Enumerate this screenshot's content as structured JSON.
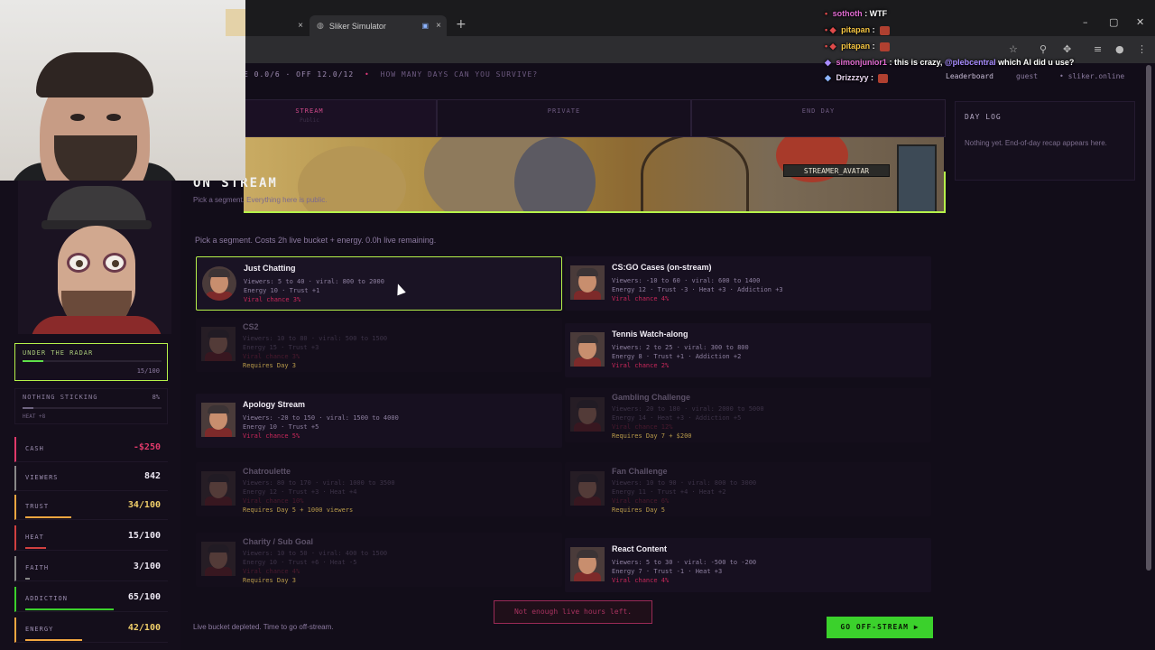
{
  "browser": {
    "tabs": [
      {
        "title": "",
        "close": "×"
      },
      {
        "title": "Sliker Simulator",
        "close": "×"
      }
    ],
    "new_tab": "+",
    "window_controls": [
      "–",
      "▢",
      "✕"
    ]
  },
  "game": {
    "status_text": "E 0.0/6 · OFF 12.0/12",
    "tagline": "HOW MANY DAYS CAN YOU SURVIVE?",
    "nav": {
      "leaderboard": "Leaderboard",
      "user": "guest",
      "site": "• sliker.online"
    },
    "stage_tabs": [
      {
        "label": "STREAM",
        "sub": "Public",
        "active": true
      },
      {
        "label": "PRIVATE",
        "sub": "",
        "active": false
      },
      {
        "label": "END DAY",
        "sub": "",
        "active": false
      }
    ],
    "banner_sign": "STREAMER_AVATAR",
    "section_title": "ON STREAM",
    "section_subtitle": "Pick a segment. Everything here is public.",
    "instructions": "Pick a segment. Costs 2h live bucket + energy. 0.0h live remaining.",
    "segments_left": [
      {
        "name": "Just Chatting",
        "stats1": "Viewers: 5 to 40 · viral: 800 to 2000",
        "stats2": "Energy 10 · Trust +1",
        "viral": "Viral chance 3%",
        "req": "",
        "selected": true,
        "locked": false
      },
      {
        "name": "CS2",
        "stats1": "Viewers: 10 to 80 · viral: 500 to 1500",
        "stats2": "Energy 15 · Trust +3",
        "viral": "Viral chance 3%",
        "req": "Requires Day 3",
        "selected": false,
        "locked": true
      },
      {
        "name": "Apology Stream",
        "stats1": "Viewers: -20 to 150 · viral: 1500 to 4000",
        "stats2": "Energy 10 · Trust +5",
        "viral": "Viral chance 5%",
        "req": "",
        "selected": false,
        "locked": false
      },
      {
        "name": "Chatroulette",
        "stats1": "Viewers: 80 to 170 · viral: 1000 to 3500",
        "stats2": "Energy 12 · Trust +3 · Heat +4",
        "viral": "Viral chance 10%",
        "req": "Requires Day 5 + 1000 viewers",
        "selected": false,
        "locked": true
      },
      {
        "name": "Charity / Sub Goal",
        "stats1": "Viewers: 10 to 50 · viral: 400 to 1500",
        "stats2": "Energy 10 · Trust +6 · Heat -5",
        "viral": "Viral chance 4%",
        "req": "Requires Day 3",
        "selected": false,
        "locked": true
      }
    ],
    "segments_right": [
      {
        "name": "CS:GO Cases (on-stream)",
        "stats1": "Viewers: -10 to 60 · viral: 600 to 1400",
        "stats2": "Energy 12 · Trust -3 · Heat +3 · Addiction +3",
        "viral": "Viral chance 4%",
        "req": "",
        "selected": false,
        "locked": false
      },
      {
        "name": "Tennis Watch-along",
        "stats1": "Viewers: 2 to 25 · viral: 300 to 800",
        "stats2": "Energy 8 · Trust +1 · Addiction +2",
        "viral": "Viral chance 2%",
        "req": "",
        "selected": false,
        "locked": false
      },
      {
        "name": "Gambling Challenge",
        "stats1": "Viewers: 20 to 180 · viral: 2000 to 5000",
        "stats2": "Energy 14 · Heat +3 · Addiction +5",
        "viral": "Viral chance 12%",
        "req": "Requires Day 7 + $200",
        "selected": false,
        "locked": true
      },
      {
        "name": "Fan Challenge",
        "stats1": "Viewers: 10 to 90 · viral: 800 to 3000",
        "stats2": "Energy 11 · Trust +4 · Heat +2",
        "viral": "Viral chance 6%",
        "req": "Requires Day 5",
        "selected": false,
        "locked": true
      },
      {
        "name": "React Content",
        "stats1": "Viewers: 5 to 30 · viral: -500 to -200",
        "stats2": "Energy 7 · Trust -1 · Heat +3",
        "viral": "Viral chance 4%",
        "req": "",
        "selected": false,
        "locked": false
      }
    ],
    "toast": "Not enough live hours left.",
    "depleted": "Live bucket depleted. Time to go off-stream.",
    "off_stream_button": "GO OFF-STREAM ▶",
    "day_log": {
      "title": "DAY LOG",
      "body": "Nothing yet. End-of-day recap appears here."
    },
    "meters": {
      "radar": {
        "label": "UNDER THE RADAR",
        "count": "15/100",
        "fraction": 0.15
      },
      "sticky": {
        "label": "NOTHING STICKING",
        "pct": "8%",
        "heat": "HEAT +8",
        "fraction": 0.08
      }
    },
    "stats": [
      {
        "key": "CASH",
        "value": "-$250",
        "color": "#e0396a",
        "bar": 0,
        "bar_color": "#e0396a"
      },
      {
        "key": "VIEWERS",
        "value": "842",
        "color": "#ece7f2",
        "bar": 0,
        "bar_color": "#888"
      },
      {
        "key": "TRUST",
        "value": "34/100",
        "color": "#f2d06a",
        "bar": 0.34,
        "bar_color": "#f2a640"
      },
      {
        "key": "HEAT",
        "value": "15/100",
        "color": "#ece7f2",
        "bar": 0.15,
        "bar_color": "#d04040"
      },
      {
        "key": "FAITH",
        "value": "3/100",
        "color": "#ece7f2",
        "bar": 0.03,
        "bar_color": "#888"
      },
      {
        "key": "ADDICTION",
        "value": "65/100",
        "color": "#ece7f2",
        "bar": 0.65,
        "bar_color": "#3bd12c"
      },
      {
        "key": "ENERGY",
        "value": "42/100",
        "color": "#f2d06a",
        "bar": 0.42,
        "bar_color": "#f2a640"
      }
    ]
  },
  "chat": [
    {
      "user": "sothoth",
      "msg": ": WTF",
      "icons": ""
    },
    {
      "user": "pitapan",
      "msg": ":",
      "icons": "• ◆",
      "emote": true
    },
    {
      "user": "pitapan",
      "msg": ":",
      "icons": "• ◆",
      "emote": true
    },
    {
      "user": "simonjunior1",
      "msg": ": this is crazy,",
      "mention": "@plebcentral",
      "tail": "which AI did u use?",
      "icons": ""
    },
    {
      "user": "Drizzzyy",
      "msg": ":",
      "icons": "",
      "emote": true
    }
  ]
}
